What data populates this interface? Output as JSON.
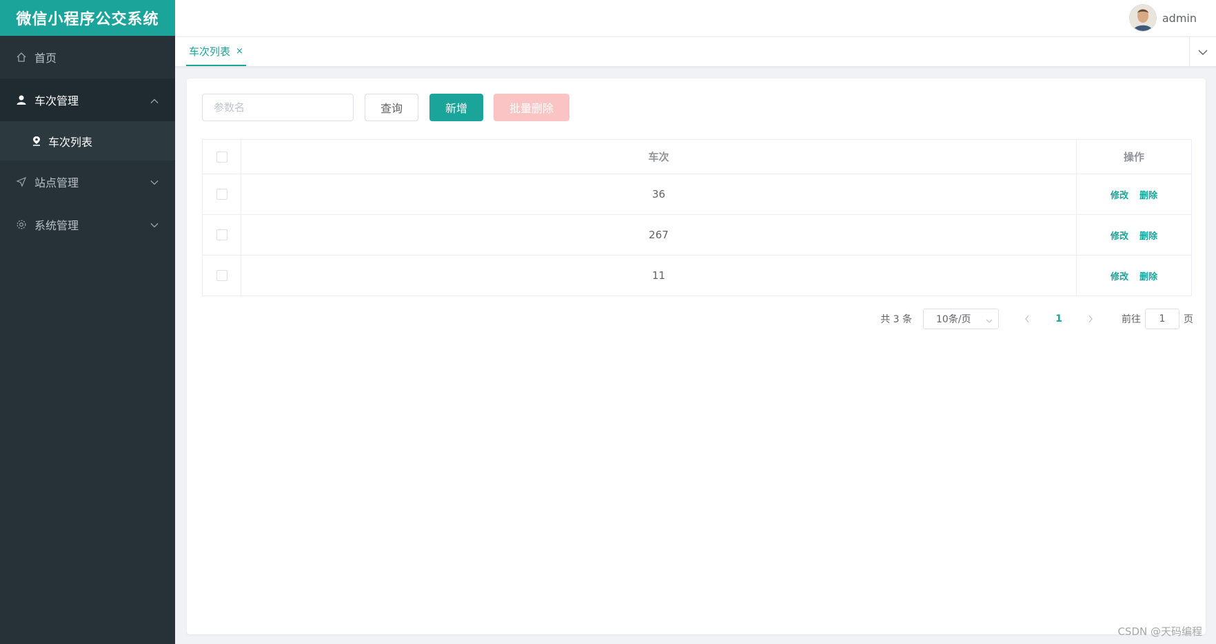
{
  "app": {
    "title": "微信小程序公交系统"
  },
  "sidebar": {
    "items": [
      {
        "label": "首页",
        "icon": "home-icon"
      },
      {
        "label": "车次管理",
        "icon": "user-icon",
        "expanded": true,
        "children": [
          {
            "label": "车次列表",
            "icon": "location-pin-icon"
          }
        ]
      },
      {
        "label": "站点管理",
        "icon": "send-icon"
      },
      {
        "label": "系统管理",
        "icon": "gear-icon"
      }
    ]
  },
  "header": {
    "username": "admin"
  },
  "tabs": [
    {
      "label": "车次列表",
      "close": "×"
    }
  ],
  "toolbar": {
    "search_placeholder": "参数名",
    "query_label": "查询",
    "add_label": "新增",
    "batch_delete_label": "批量删除"
  },
  "table": {
    "columns": [
      "车次",
      "操作"
    ],
    "rows": [
      {
        "number": "36"
      },
      {
        "number": "267"
      },
      {
        "number": "11"
      }
    ],
    "edit_label": "修改",
    "delete_label": "删除"
  },
  "pagination": {
    "total_text": "共 3 条",
    "page_size": "10条/页",
    "current_page": "1",
    "goto_prefix": "前往",
    "goto_value": "1",
    "goto_suffix": "页"
  },
  "watermark": "CSDN @天码编程",
  "colors": {
    "accent": "#1aa49a",
    "sidebar_bg": "#263238",
    "danger_disabled": "#fbc4c4"
  }
}
